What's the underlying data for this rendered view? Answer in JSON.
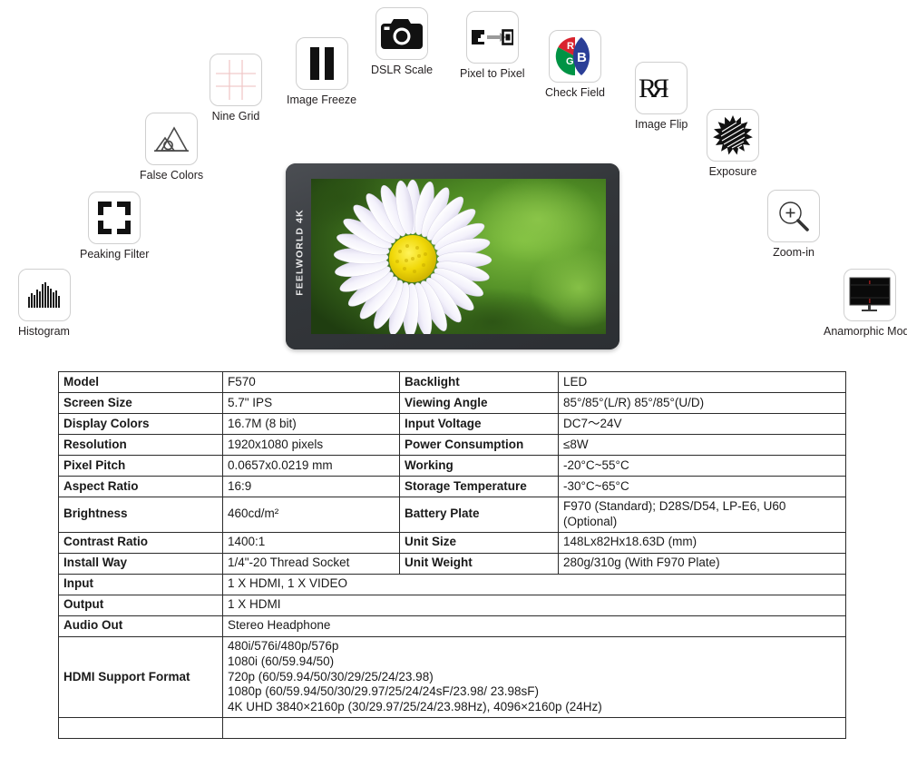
{
  "product": {
    "brand": "FEELWORLD 4K",
    "device_name": "FEELWORLD F570 field monitor"
  },
  "features": [
    {
      "id": "histogram",
      "label": "Histogram",
      "icon": "histogram-icon"
    },
    {
      "id": "peaking-filter",
      "label": "Peaking Filter",
      "icon": "peaking-filter-icon"
    },
    {
      "id": "false-colors",
      "label": "False Colors",
      "icon": "false-colors-icon"
    },
    {
      "id": "nine-grid",
      "label": "Nine Grid",
      "icon": "nine-grid-icon"
    },
    {
      "id": "image-freeze",
      "label": "Image Freeze",
      "icon": "pause-icon"
    },
    {
      "id": "dslr-scale",
      "label": "DSLR Scale",
      "icon": "camera-icon"
    },
    {
      "id": "pixel-to-pixel",
      "label": "Pixel to Pixel",
      "icon": "pixel-to-pixel-icon"
    },
    {
      "id": "check-field",
      "label": "Check Field",
      "icon": "rgb-check-field-icon"
    },
    {
      "id": "image-flip",
      "label": "Image Flip",
      "icon": "image-flip-icon"
    },
    {
      "id": "exposure",
      "label": "Exposure",
      "icon": "sun-exposure-icon"
    },
    {
      "id": "zoom-in",
      "label": "Zoom-in",
      "icon": "magnifier-plus-icon"
    },
    {
      "id": "anamorphic-mode",
      "label": "Anamorphic Mode",
      "icon": "monitor-icon"
    }
  ],
  "check_field_letters": {
    "r": "R",
    "g": "G",
    "b": "B"
  },
  "image_flip_text": {
    "left": "R",
    "right": "Я"
  },
  "colors": {
    "icon_border": "#cfcfcf",
    "label_text": "#231f20",
    "table_border": "#2b2b2b",
    "check_field_red": "#d9232e",
    "check_field_green": "#009344",
    "check_field_blue": "#2b3f97",
    "grid_line": "#f0c9c9",
    "monitor_body": "#3c3f44",
    "flower_center": "#e8d408",
    "flower_petal": "#f2f2fa",
    "background_green": "#3f7a21"
  },
  "spec_table": {
    "paired_rows": [
      {
        "k1": "Model",
        "v1": "F570",
        "k2": "Backlight",
        "v2": "LED"
      },
      {
        "k1": "Screen Size",
        "v1": "5.7\" IPS",
        "k2": "Viewing Angle",
        "v2": "85°/85°(L/R) 85°/85°(U/D)"
      },
      {
        "k1": "Display Colors",
        "v1": "16.7M (8 bit)",
        "k2": "Input Voltage",
        "v2": "DC7～24V"
      },
      {
        "k1": "Resolution",
        "v1": "1920x1080 pixels",
        "k2": "Power Consumption",
        "v2": "≤8W"
      },
      {
        "k1": "Pixel Pitch",
        "v1": "0.0657x0.0219 mm",
        "k2": "Working",
        "v2": "-20°C~55°C"
      },
      {
        "k1": "Aspect Ratio",
        "v1": "16:9",
        "k2": "Storage Temperature",
        "v2": "-30°C~65°C"
      },
      {
        "k1": "Brightness",
        "v1": "460cd/m²",
        "k2": "Battery Plate",
        "v2": "F970 (Standard); D28S/D54, LP-E6, U60 (Optional)"
      },
      {
        "k1": "Contrast Ratio",
        "v1": "1400:1",
        "k2": "Unit Size",
        "v2": "148Lx82Hx18.63D (mm)"
      },
      {
        "k1": "Install Way",
        "v1": "1/4\"-20 Thread Socket",
        "k2": "Unit Weight",
        "v2": "280g/310g (With F970 Plate)"
      }
    ],
    "full_rows": [
      {
        "k": "Input",
        "v": "1 X HDMI, 1 X VIDEO"
      },
      {
        "k": "Output",
        "v": "1 X HDMI"
      },
      {
        "k": "Audio Out",
        "v": "Stereo Headphone"
      }
    ],
    "hdmi_format": {
      "key": "HDMI Support Format",
      "lines": [
        "480i/576i/480p/576p",
        "1080i (60/59.94/50)",
        "720p (60/59.94/50/30/29/25/24/23.98)",
        "1080p (60/59.94/50/30/29.97/25/24/24sF/23.98/ 23.98sF)",
        "4K UHD 3840×2160p (30/29.97/25/24/23.98Hz), 4096×2160p (24Hz)"
      ]
    }
  }
}
